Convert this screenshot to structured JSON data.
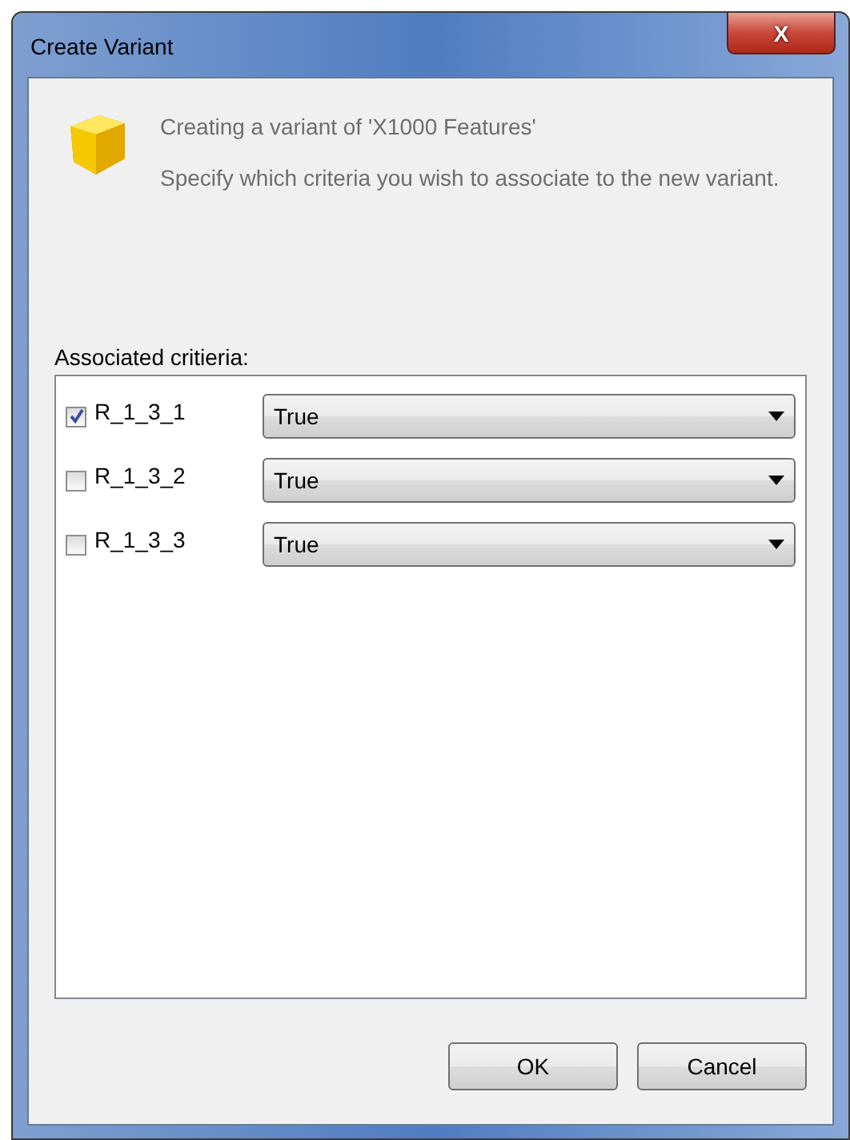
{
  "window": {
    "title": "Create Variant",
    "close_label": "X"
  },
  "header": {
    "title": "Creating a variant of 'X1000 Features'",
    "description": "Specify which criteria you wish to associate to the new variant."
  },
  "criteria_label": "Associated critieria:",
  "criteria": [
    {
      "name": "R_1_3_1",
      "checked": true,
      "value": "True"
    },
    {
      "name": "R_1_3_2",
      "checked": false,
      "value": "True"
    },
    {
      "name": "R_1_3_3",
      "checked": false,
      "value": "True"
    }
  ],
  "buttons": [
    "OK",
    "Cancel"
  ]
}
